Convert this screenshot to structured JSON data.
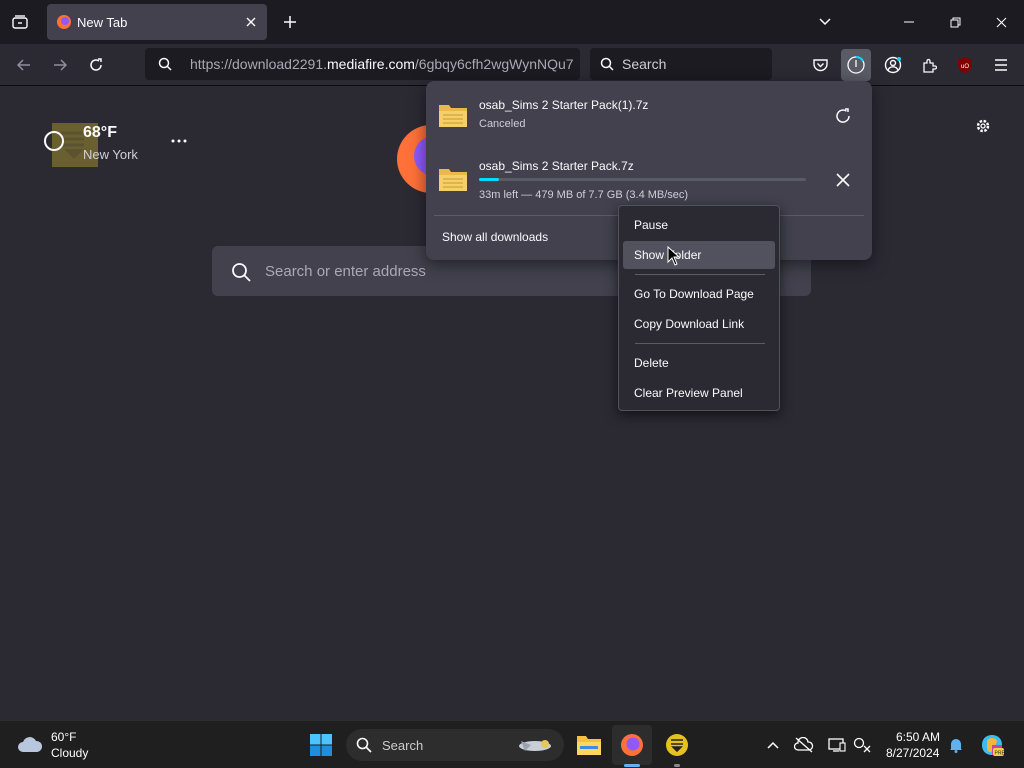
{
  "tab": {
    "title": "New Tab"
  },
  "url": {
    "prefix": "https://download2291.",
    "domain": "mediafire.com",
    "path": "/6gbqy6cfh2wgWynNQu7"
  },
  "searchbar": {
    "placeholder": "Search"
  },
  "weather_widget": {
    "temperature": "68°F",
    "location": "New York"
  },
  "newtab_search": {
    "placeholder": "Search or enter address"
  },
  "downloads": {
    "items": [
      {
        "filename": "osab_Sims 2 Starter Pack(1).7z",
        "status": "Canceled"
      },
      {
        "filename": "osab_Sims 2 Starter Pack.7z",
        "status": "33m left — 479 MB of 7.7 GB (3.4 MB/sec)",
        "progress": 0.06
      }
    ],
    "show_all_label": "Show all downloads"
  },
  "context_menu": {
    "items": [
      {
        "label": "Pause"
      },
      {
        "label": "Show Folder"
      },
      {
        "label": "Go To Download Page"
      },
      {
        "label": "Copy Download Link"
      },
      {
        "label": "Delete"
      },
      {
        "label": "Clear Preview Panel"
      }
    ]
  },
  "taskbar": {
    "weather_temp": "60°F",
    "weather_desc": "Cloudy",
    "search_placeholder": "Search",
    "time": "6:50 AM",
    "date": "8/27/2024"
  },
  "colors": {
    "accent": "#00ddff",
    "panel": "#42414d",
    "background": "#2b2a33"
  }
}
